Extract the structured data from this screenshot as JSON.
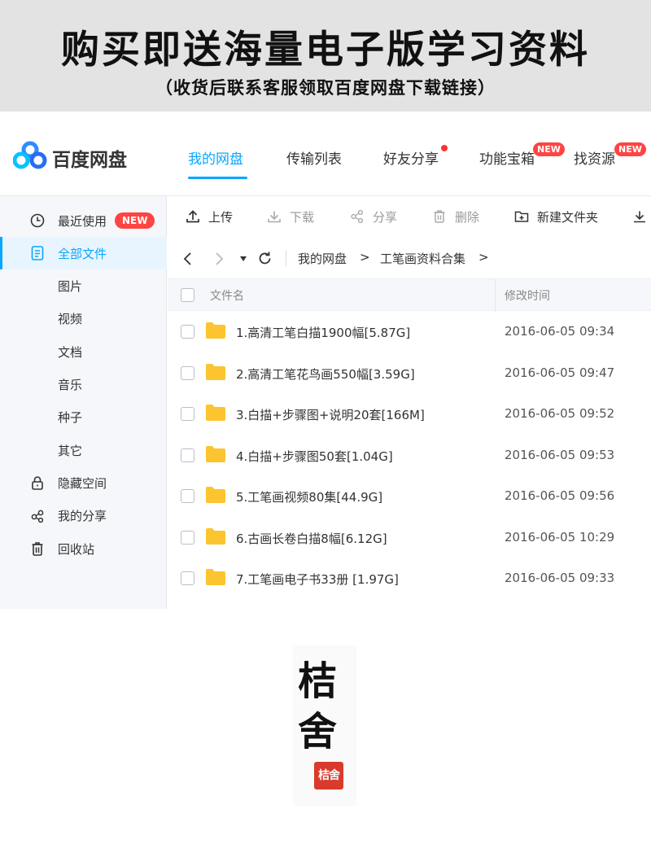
{
  "banner": {
    "title": "购买即送海量电子版学习资料",
    "subtitle": "（收货后联系客服领取百度网盘下载链接）"
  },
  "app": {
    "logo_text": "百度网盘",
    "nav": [
      {
        "label": "我的网盘",
        "active": true
      },
      {
        "label": "传输列表"
      },
      {
        "label": "好友分享",
        "dot": true
      },
      {
        "label": "功能宝箱",
        "badge": "NEW"
      },
      {
        "label": "找资源",
        "badge": "NEW"
      }
    ],
    "sidebar": {
      "items": [
        {
          "label": "最近使用",
          "icon": "clock-icon",
          "badge": "NEW"
        },
        {
          "label": "全部文件",
          "icon": "document-icon",
          "active": true
        },
        {
          "label": "图片"
        },
        {
          "label": "视频"
        },
        {
          "label": "文档"
        },
        {
          "label": "音乐"
        },
        {
          "label": "种子"
        },
        {
          "label": "其它"
        },
        {
          "label": "隐藏空间",
          "icon": "lock-icon"
        },
        {
          "label": "我的分享",
          "icon": "share-icon"
        },
        {
          "label": "回收站",
          "icon": "trash-icon"
        }
      ]
    },
    "toolbar": {
      "upload": "上传",
      "download": "下载",
      "share": "分享",
      "delete": "删除",
      "new_folder": "新建文件夹"
    },
    "breadcrumb": {
      "root": "我的网盘",
      "sep": ">",
      "folder": "工笔画资料合集",
      "trail": ">"
    },
    "table": {
      "col_name": "文件名",
      "col_time": "修改时间",
      "rows": [
        {
          "name": "1.高清工笔白描1900幅[5.87G]",
          "time": "2016-06-05 09:34"
        },
        {
          "name": "2.高清工笔花鸟画550幅[3.59G]",
          "time": "2016-06-05 09:47"
        },
        {
          "name": "3.白描+步骤图+说明20套[166M]",
          "time": "2016-06-05 09:52"
        },
        {
          "name": "4.白描+步骤图50套[1.04G]",
          "time": "2016-06-05 09:53"
        },
        {
          "name": "5.工笔画视频80集[44.9G]",
          "time": "2016-06-05 09:56"
        },
        {
          "name": "6.古画长卷白描8幅[6.12G]",
          "time": "2016-06-05 10:29"
        },
        {
          "name": "7.工笔画电子书33册 [1.97G]",
          "time": "2016-06-05 09:33"
        }
      ]
    }
  },
  "signature": {
    "line1": "桔",
    "line2": "舍",
    "stamp": "桔舍"
  },
  "colors": {
    "accent": "#06a7ff",
    "badge": "#ff4444",
    "folder": "#fcc52f",
    "stamp": "#d93a2b"
  }
}
